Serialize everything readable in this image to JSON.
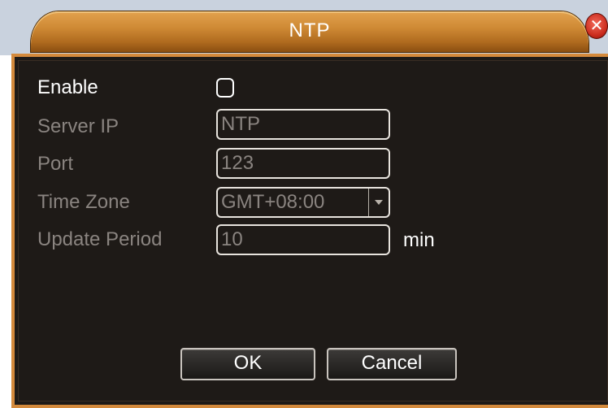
{
  "dialog": {
    "title": "NTP",
    "close_glyph": "✕"
  },
  "form": {
    "enable": {
      "label": "Enable",
      "checked": false
    },
    "server_ip": {
      "label": "Server IP",
      "value": "NTP"
    },
    "port": {
      "label": "Port",
      "value": "123"
    },
    "time_zone": {
      "label": "Time Zone",
      "value": "GMT+08:00"
    },
    "update_period": {
      "label": "Update Period",
      "value": "10",
      "unit": "min"
    }
  },
  "buttons": {
    "ok_label": "OK",
    "cancel_label": "Cancel"
  },
  "icons": {
    "close": "close-icon",
    "dropdown": "chevron-down-icon"
  },
  "colors": {
    "title_bar": "#cf8a35",
    "frame_border": "#d48a3c",
    "body_background": "#1e1a17",
    "close_button": "#c92a1c"
  }
}
